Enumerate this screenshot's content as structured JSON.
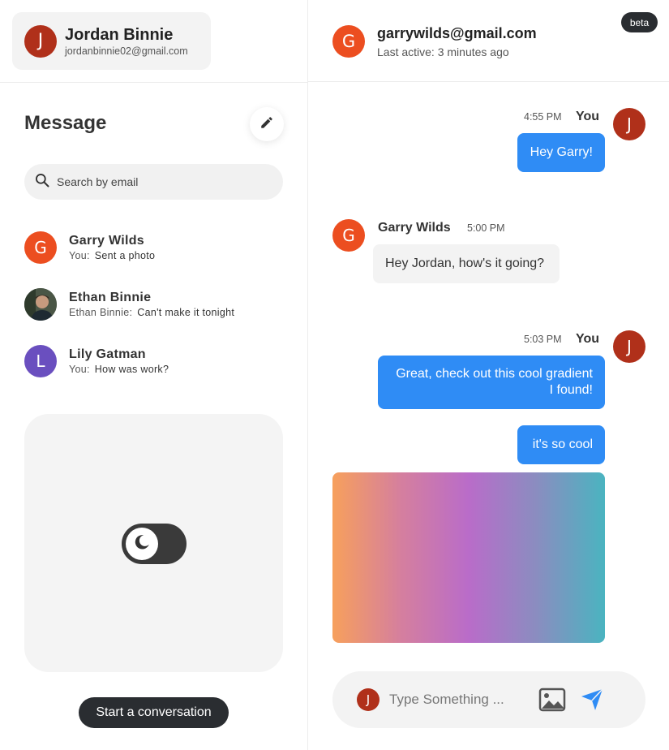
{
  "current_user": {
    "initial": "J",
    "name": "Jordan Binnie",
    "email": "jordanbinnie02@gmail.com",
    "color": "#b0301a"
  },
  "sidebar": {
    "title": "Message",
    "search": {
      "placeholder": "Search by email"
    },
    "conversations": [
      {
        "initial": "G",
        "name": "Garry Wilds",
        "from": "You:",
        "preview": "Sent a photo",
        "color": "#ec4e20"
      },
      {
        "initial": "",
        "name": "Ethan Binnie",
        "from": "Ethan Binnie:",
        "preview": "Can't make it tonight",
        "color": "#3a4a3a"
      },
      {
        "initial": "L",
        "name": "Lily Gatman",
        "from": "You:",
        "preview": "How was work?",
        "color": "#6a4fbf"
      }
    ],
    "theme_toggle": {
      "state": "dark-mode-off",
      "icon": "moon-icon"
    },
    "start_button": "Start a conversation"
  },
  "chat": {
    "header": {
      "initial": "G",
      "email": "garrywilds@gmail.com",
      "status": "Last active: 3 minutes ago",
      "badge": "beta",
      "color": "#ec4e20"
    },
    "messages": [
      {
        "sender": "You",
        "time": "4:55 PM",
        "texts": [
          "Hey Garry!"
        ]
      },
      {
        "sender": "Garry Wilds",
        "time": "5:00 PM",
        "texts": [
          "Hey Jordan, how's it going?"
        ]
      },
      {
        "sender": "You",
        "time": "5:03 PM",
        "texts": [
          "Great, check out this cool gradient I found!",
          "it's so cool"
        ],
        "image": "gradient-image"
      }
    ],
    "composer": {
      "placeholder": "Type Something ...",
      "avatar_initial": "J"
    },
    "colors": {
      "outgoing": "#2f8cf5",
      "incoming": "#f3f3f3"
    }
  }
}
